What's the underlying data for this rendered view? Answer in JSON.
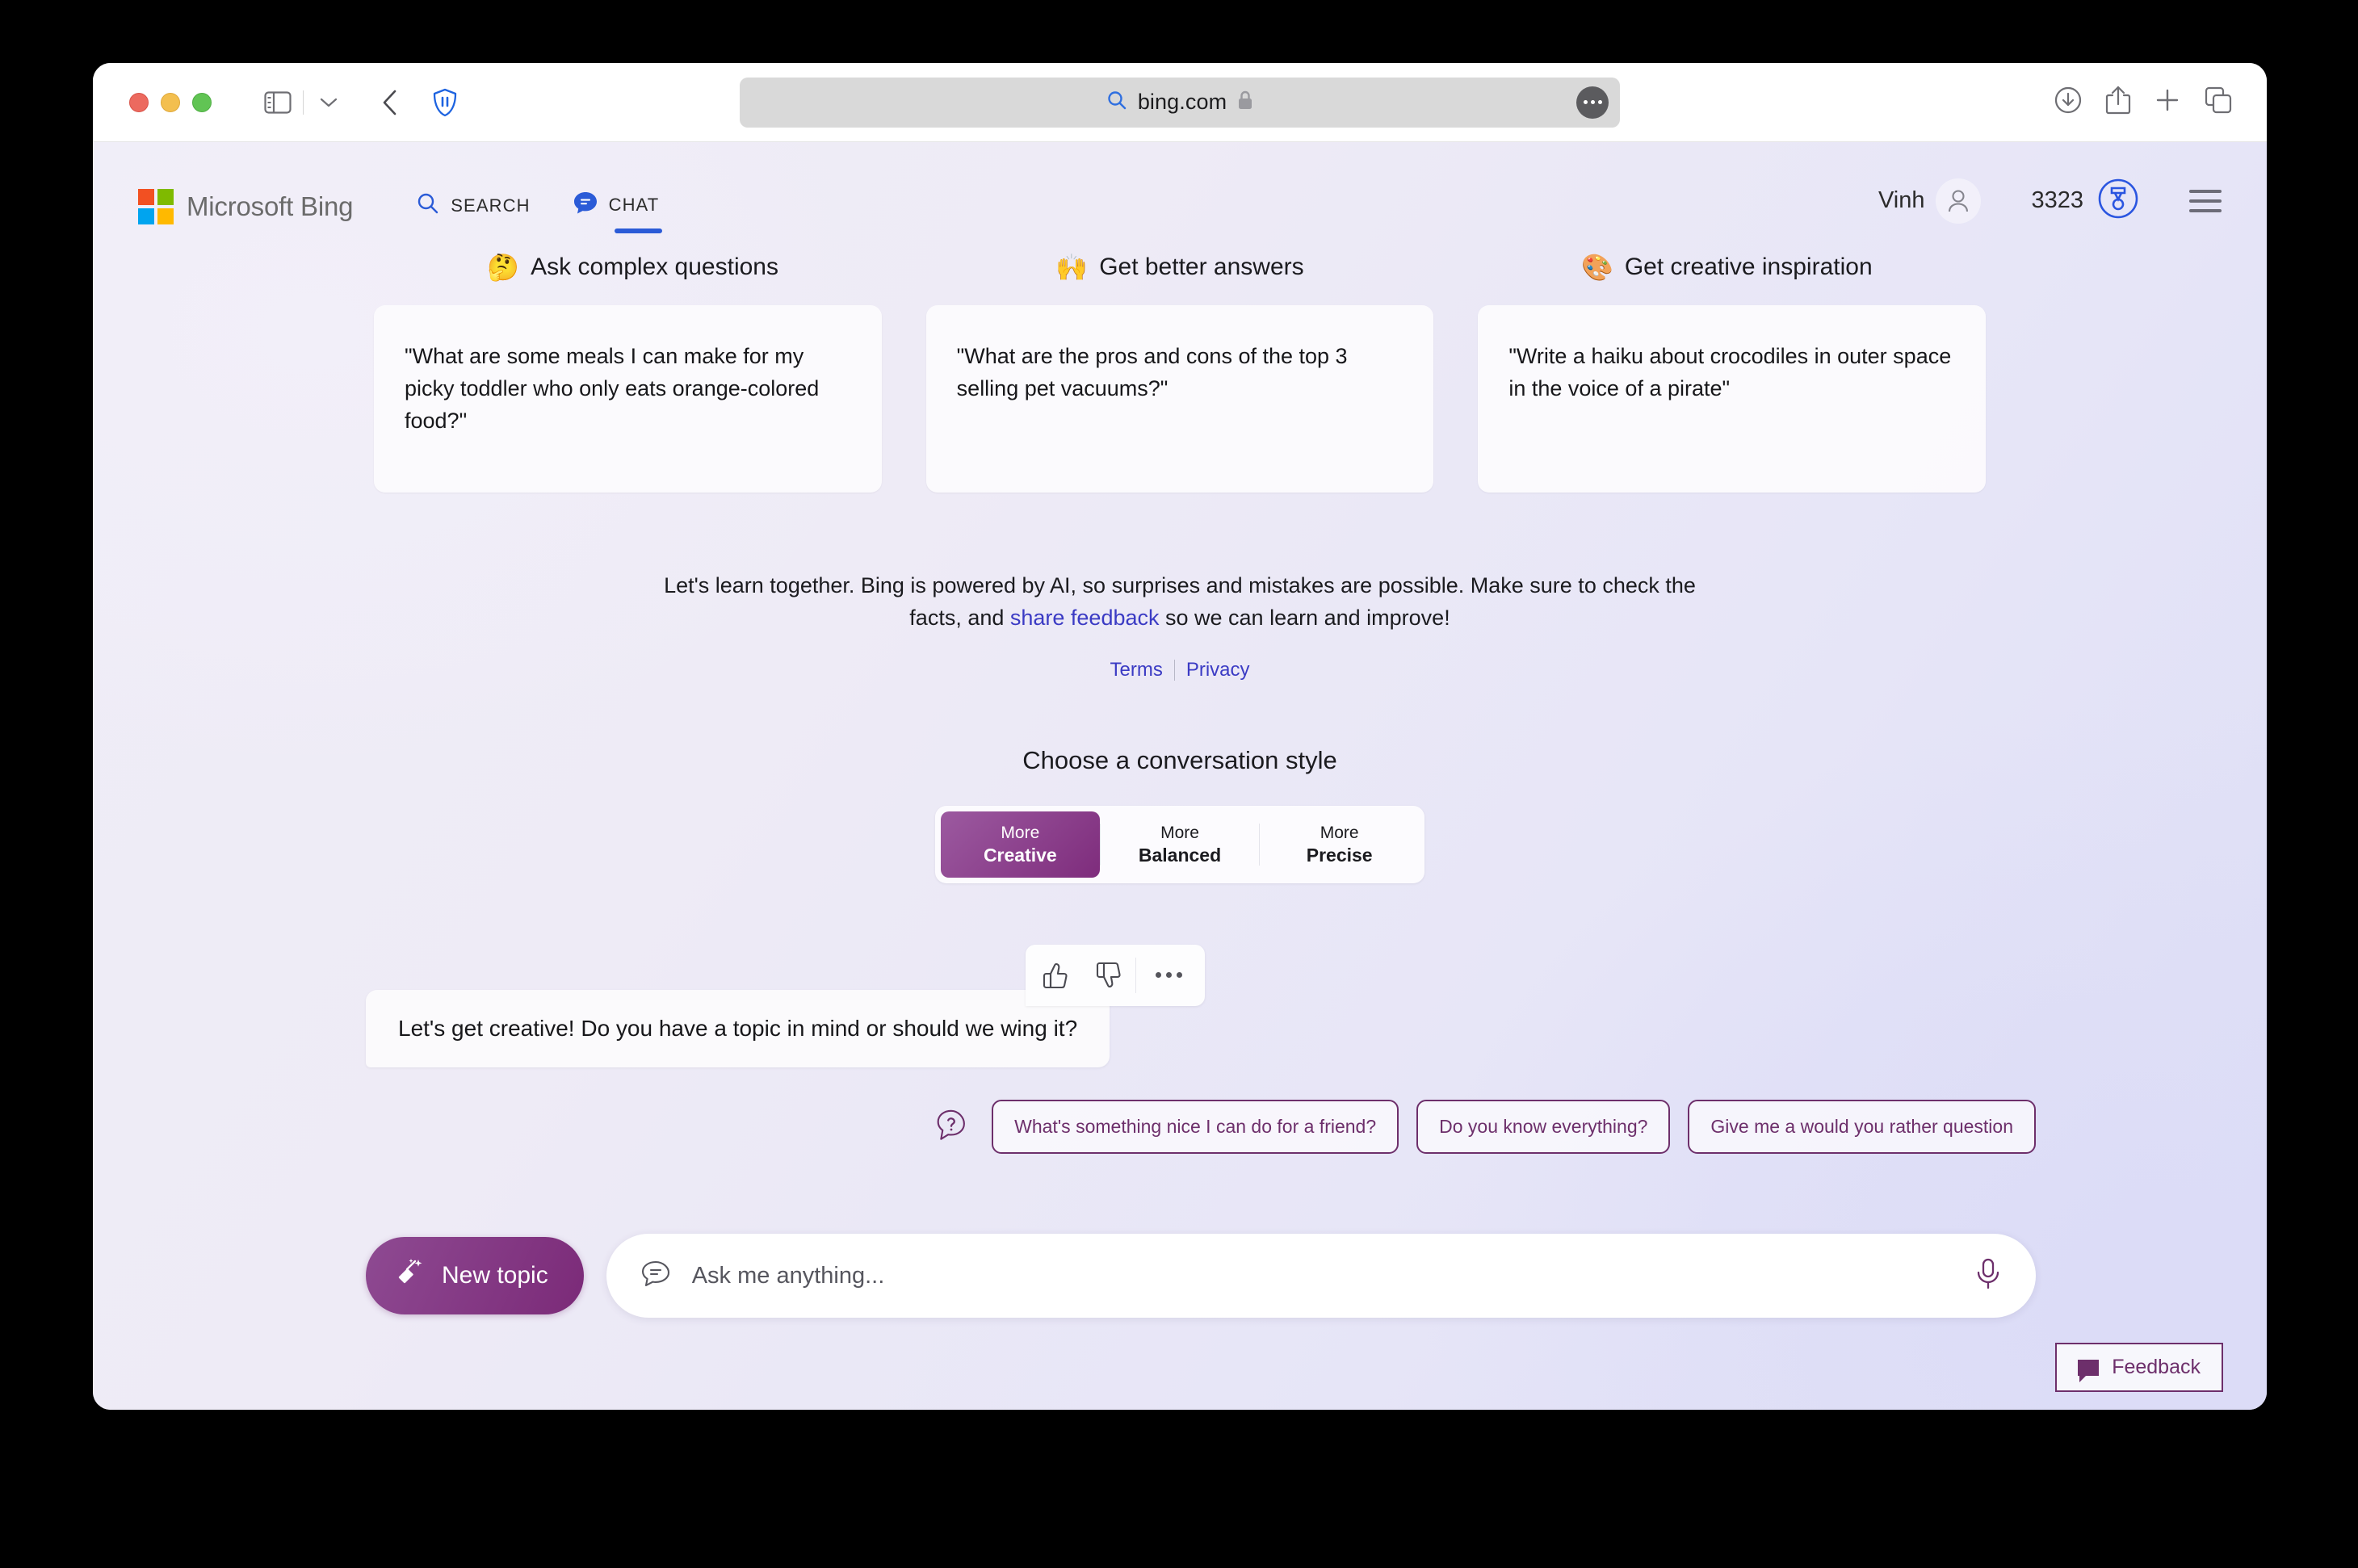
{
  "browser": {
    "url": "bing.com",
    "url_icons": {
      "search": "search-icon",
      "lock": "lock-icon"
    },
    "toolbar_icons": [
      "sidebar-icon",
      "chevron-down-icon",
      "back-icon",
      "shield-pause-icon"
    ],
    "right_icons": [
      "downloads-icon",
      "share-icon",
      "new-tab-icon",
      "tab-overview-icon"
    ]
  },
  "header": {
    "logo_text": "Microsoft Bing",
    "tabs": [
      {
        "label": "SEARCH",
        "icon": "search-icon",
        "active": false
      },
      {
        "label": "CHAT",
        "icon": "chat-bubble-icon",
        "active": true
      }
    ],
    "user_name": "Vinh",
    "rewards_count": "3323",
    "rewards_icon": "rewards-medal-icon",
    "menu_icon": "hamburger-menu-icon"
  },
  "promo": {
    "columns": [
      {
        "emoji": "🤔",
        "title": "Ask complex questions",
        "example": "\"What are some meals I can make for my picky toddler who only eats orange-colored food?\""
      },
      {
        "emoji": "🙌",
        "title": "Get better answers",
        "example": "\"What are the pros and cons of the top 3 selling pet vacuums?\""
      },
      {
        "emoji": "🎨",
        "title": "Get creative inspiration",
        "example": "\"Write a haiku about crocodiles in outer space in the voice of a pirate\""
      }
    ]
  },
  "disclaimer": {
    "text_before": "Let's learn together. Bing is powered by AI, so surprises and mistakes are possible. Make sure to check the facts, and ",
    "link": "share feedback",
    "text_after": " so we can learn and improve!",
    "terms": "Terms",
    "privacy": "Privacy"
  },
  "conversation_style": {
    "title": "Choose a conversation style",
    "options": [
      {
        "top": "More",
        "bottom": "Creative",
        "selected": true
      },
      {
        "top": "More",
        "bottom": "Balanced",
        "selected": false
      },
      {
        "top": "More",
        "bottom": "Precise",
        "selected": false
      }
    ]
  },
  "chat": {
    "message": "Let's get creative! Do you have a topic in mind or should we wing it?",
    "actions": [
      "thumbs-up-icon",
      "thumbs-down-icon",
      "more-options-icon"
    ],
    "suggestion_icon": "question-bubble-icon",
    "suggestions": [
      "What's something nice I can do for a friend?",
      "Do you know everything?",
      "Give me a would you rather question"
    ]
  },
  "composer": {
    "new_topic_label": "New topic",
    "new_topic_icon": "broom-sparkle-icon",
    "input_icon": "chat-bubble-icon",
    "input_value": "",
    "input_placeholder": "Ask me anything...",
    "mic_icon": "microphone-icon"
  },
  "feedback": {
    "label": "Feedback",
    "icon": "feedback-bubble-icon"
  },
  "colors": {
    "accent_purple": "#7b2a78",
    "bing_blue": "#2b5bd7",
    "link_blue": "#3b3bc4"
  }
}
